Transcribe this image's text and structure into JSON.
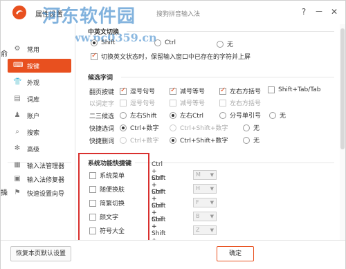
{
  "window": {
    "title": "属性设置",
    "app_name": "搜狗拼音输入法",
    "help_label": "?",
    "min_label": "－",
    "close_label": "✕"
  },
  "watermark": {
    "title": "河东软件园",
    "url": "www.pc0359.cn"
  },
  "edge_glyphs": [
    "俞",
    "操"
  ],
  "sidebar": {
    "items": [
      {
        "label": "常用",
        "icon": "wrench-icon",
        "glyph": "⚙"
      },
      {
        "label": "按键",
        "icon": "keyboard-icon",
        "glyph": "⌨"
      },
      {
        "label": "外观",
        "icon": "shirt-icon",
        "glyph": "👕"
      },
      {
        "label": "词库",
        "icon": "book-icon",
        "glyph": "▤"
      },
      {
        "label": "账户",
        "icon": "user-icon",
        "glyph": "♟"
      },
      {
        "label": "搜索",
        "icon": "search-icon",
        "glyph": "⌕"
      },
      {
        "label": "高级",
        "icon": "gear-icon",
        "glyph": "✻"
      }
    ],
    "tools": [
      {
        "label": "输入法管理器",
        "icon": "manager-icon",
        "glyph": "▦"
      },
      {
        "label": "输入法修复器",
        "icon": "repair-icon",
        "glyph": "▣"
      },
      {
        "label": "快速设置向导",
        "icon": "flag-icon",
        "glyph": "⚑"
      }
    ]
  },
  "zh_en": {
    "title": "中英文切换",
    "options": [
      "Shift",
      "Ctrl",
      "无"
    ],
    "keep_input_label": "切换英文状态时，保留输入窗口中已存在的字符并上屏"
  },
  "candidates": {
    "title": "候选字词",
    "page_turn": {
      "label": "翻页按键",
      "options": [
        "逗号句号",
        "减号等号",
        "左右方括号",
        "Shift+Tab/Tab"
      ]
    },
    "word_select": {
      "label": "以词定字",
      "options": [
        "逗号句号",
        "减号等号",
        "左右方括号"
      ]
    },
    "second_third": {
      "label": "二三候选",
      "options": [
        "左右Shift",
        "左右Ctrl",
        "分号单引号",
        "无"
      ]
    },
    "quick_select": {
      "label": "快捷选词",
      "options": [
        "Ctrl+数字",
        "Ctrl+Shift+数字",
        "无"
      ]
    },
    "quick_delete": {
      "label": "快捷删词",
      "options": [
        "Ctrl+数字",
        "Ctrl+Shift+数字",
        "无"
      ]
    }
  },
  "hotkeys": {
    "title": "系统功能快捷键",
    "combo_label": "Ctrl + Shift +",
    "items": [
      {
        "label": "系统菜单",
        "key": "M"
      },
      {
        "label": "随便换肤",
        "key": "H"
      },
      {
        "label": "简繁切换",
        "key": "F"
      },
      {
        "label": "颜文字",
        "key": "B"
      },
      {
        "label": "符号大全",
        "key": "Z"
      }
    ]
  },
  "footer": {
    "restore_label": "恢复本页默认设置",
    "ok_label": "确定"
  },
  "colors": {
    "accent": "#e8501f",
    "highlight": "#d9302e"
  }
}
